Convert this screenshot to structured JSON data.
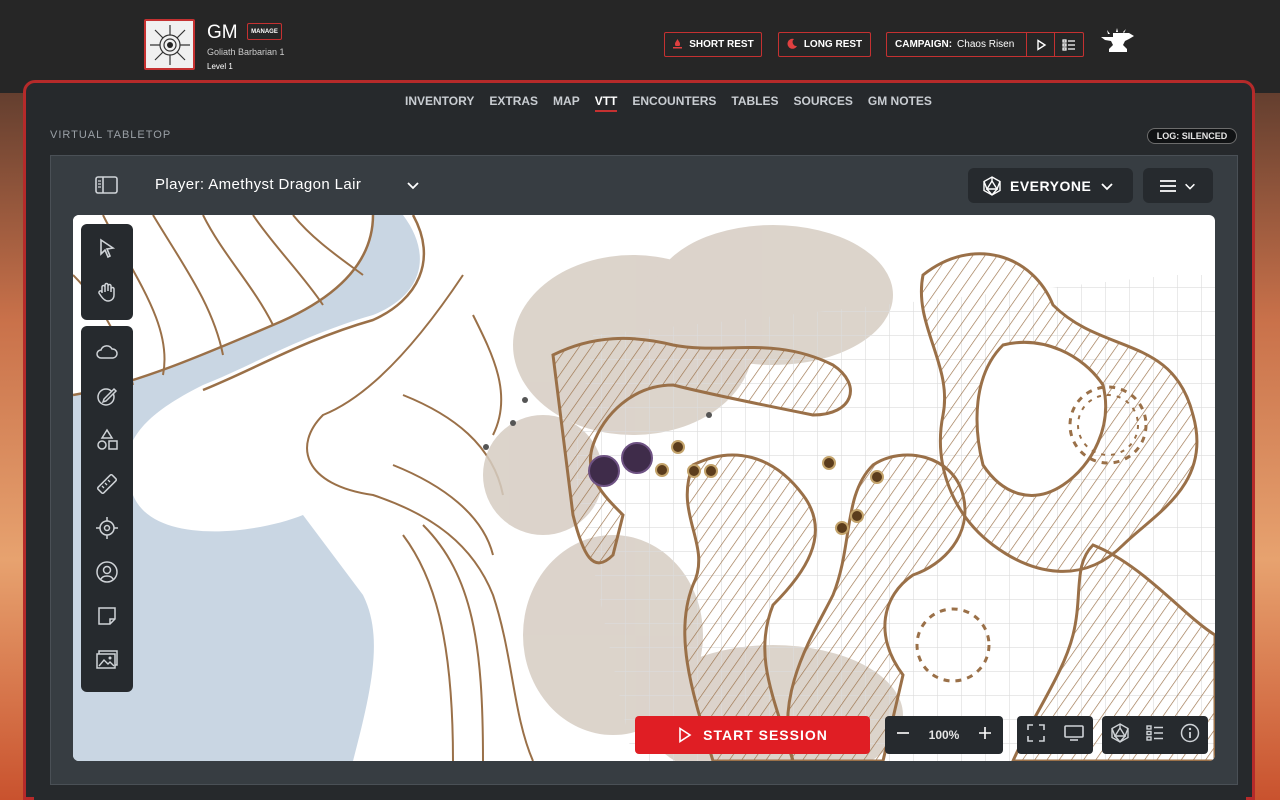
{
  "header": {
    "character_name": "GM",
    "manage_label": "MANAGE",
    "subtitle": "Goliath  Barbarian 1",
    "level": "Level 1",
    "short_rest_label": "SHORT REST",
    "long_rest_label": "LONG REST",
    "campaign_label": "CAMPAIGN:",
    "campaign_name": "Chaos Risen",
    "icons": {
      "short_rest": "campfire-icon",
      "long_rest": "moon-icon",
      "play": "play-icon",
      "list": "list-icon",
      "logo": "anvil-logo-icon"
    }
  },
  "nav": {
    "tabs": [
      {
        "label": "INVENTORY"
      },
      {
        "label": "EXTRAS"
      },
      {
        "label": "MAP"
      },
      {
        "label": "VTT",
        "active": true
      },
      {
        "label": "ENCOUNTERS"
      },
      {
        "label": "TABLES"
      },
      {
        "label": "SOURCES"
      },
      {
        "label": "GM NOTES"
      }
    ]
  },
  "vtt": {
    "section_title": "VIRTUAL TABLETOP",
    "log_status": "LOG: SILENCED",
    "scene_name": "Player: Amethyst Dragon Lair",
    "audience_label": "EVERYONE",
    "start_session_label": "START SESSION",
    "zoom_level": "100%",
    "tools": [
      {
        "name": "select-tool",
        "icon": "cursor-icon"
      },
      {
        "name": "pan-tool",
        "icon": "hand-icon"
      },
      {
        "name": "fog-tool",
        "icon": "cloud-icon"
      },
      {
        "name": "draw-tool",
        "icon": "pencil-icon"
      },
      {
        "name": "shapes-tool",
        "icon": "shapes-icon"
      },
      {
        "name": "measure-tool",
        "icon": "ruler-icon"
      },
      {
        "name": "target-tool",
        "icon": "crosshair-icon"
      },
      {
        "name": "token-tool",
        "icon": "user-circle-icon"
      },
      {
        "name": "note-tool",
        "icon": "sticky-note-icon"
      },
      {
        "name": "image-tool",
        "icon": "image-icon"
      }
    ]
  },
  "colors": {
    "accent": "#c53131",
    "start_button": "#e01e24",
    "panel": "#262a2e",
    "map_ink": "#9a7048",
    "water": "#c9d6e3"
  }
}
